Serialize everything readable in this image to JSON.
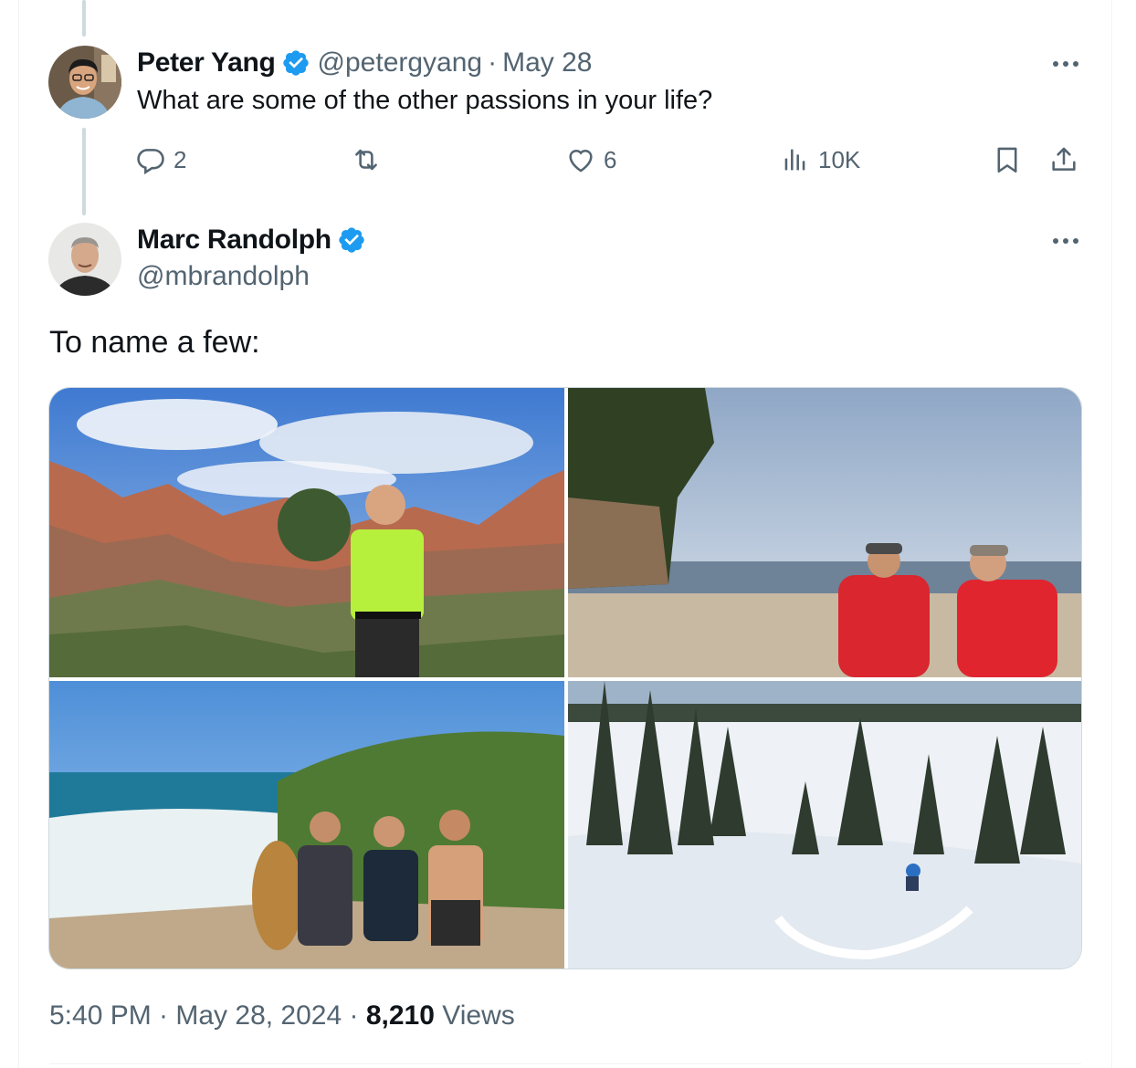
{
  "reply": {
    "display_name": "Peter Yang",
    "handle": "@petergyang",
    "separator": "·",
    "date": "May 28",
    "text": "What are some of the other passions in your life?",
    "stats": {
      "replies": "2",
      "retweets": "",
      "likes": "6",
      "views": "10K"
    }
  },
  "main": {
    "display_name": "Marc Randolph",
    "handle": "@mbrandolph",
    "text": "To name a few:",
    "photos": [
      {
        "name": "photo-hiking",
        "subject": "runner in neon shirt on desert mountain trail"
      },
      {
        "name": "photo-beach",
        "subject": "two men in red jackets walking on beach"
      },
      {
        "name": "photo-surf",
        "subject": "three men with surfboards on rocky beach"
      },
      {
        "name": "photo-ski",
        "subject": "skier in deep powder snow among pines"
      }
    ],
    "timestamp": "5:40 PM · May 28, 2024",
    "separator": " · ",
    "view_count": "8,210",
    "views_label": " Views"
  },
  "colors": {
    "accent": "#1d9bf0",
    "muted": "#536471",
    "text": "#0f1419",
    "border": "#cfd9de"
  },
  "icons": [
    "reply-icon",
    "retweet-icon",
    "like-icon",
    "views-icon",
    "bookmark-icon",
    "share-icon",
    "verified-icon",
    "more-icon"
  ]
}
